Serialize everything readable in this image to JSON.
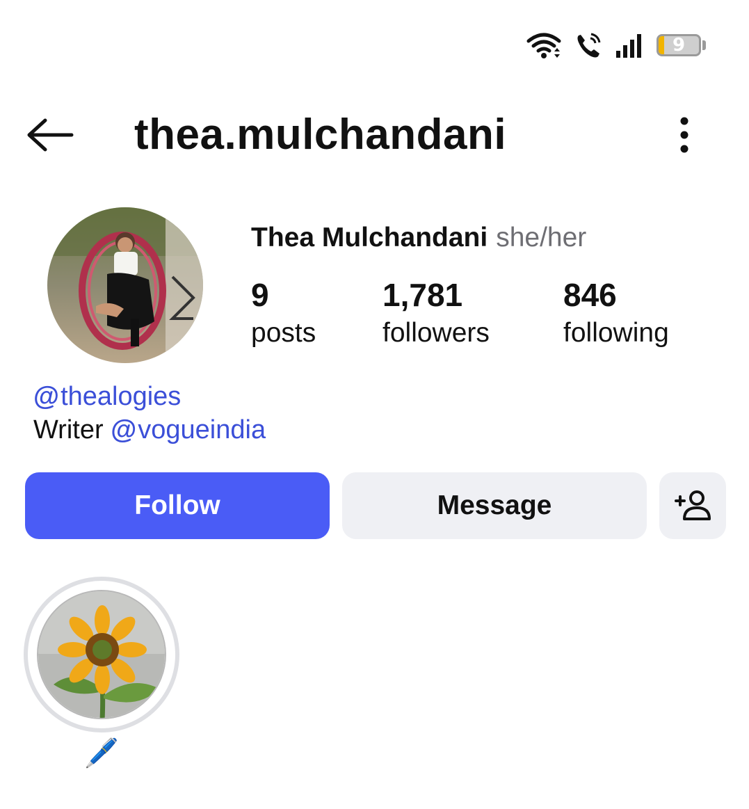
{
  "status_bar": {
    "icons": [
      "wifi-icon",
      "wifi-calling-icon",
      "cellular-signal-icon",
      "battery-icon"
    ],
    "battery_level": "9"
  },
  "header": {
    "username": "thea.mulchandani",
    "back_icon": "arrow-left-icon",
    "menu_icon": "more-vertical-icon"
  },
  "profile": {
    "full_name": "Thea Mulchandani",
    "pronouns": "she/her",
    "stats": [
      {
        "count": "9",
        "label": "posts"
      },
      {
        "count": "1,781",
        "label": "followers"
      },
      {
        "count": "846",
        "label": "following"
      }
    ],
    "bio": {
      "threads_handle": "thealogies",
      "line2_text": "Writer",
      "line2_link": "vogueindia"
    }
  },
  "actions": {
    "follow_label": "Follow",
    "message_label": "Message",
    "add_user_icon": "add-user-icon"
  },
  "highlights": [
    {
      "label": "🖊️"
    }
  ],
  "colors": {
    "accent": "#4a5cf6",
    "link": "#3b4fd8",
    "secondary_button": "#eff0f4",
    "muted_text": "#6e6e73"
  }
}
